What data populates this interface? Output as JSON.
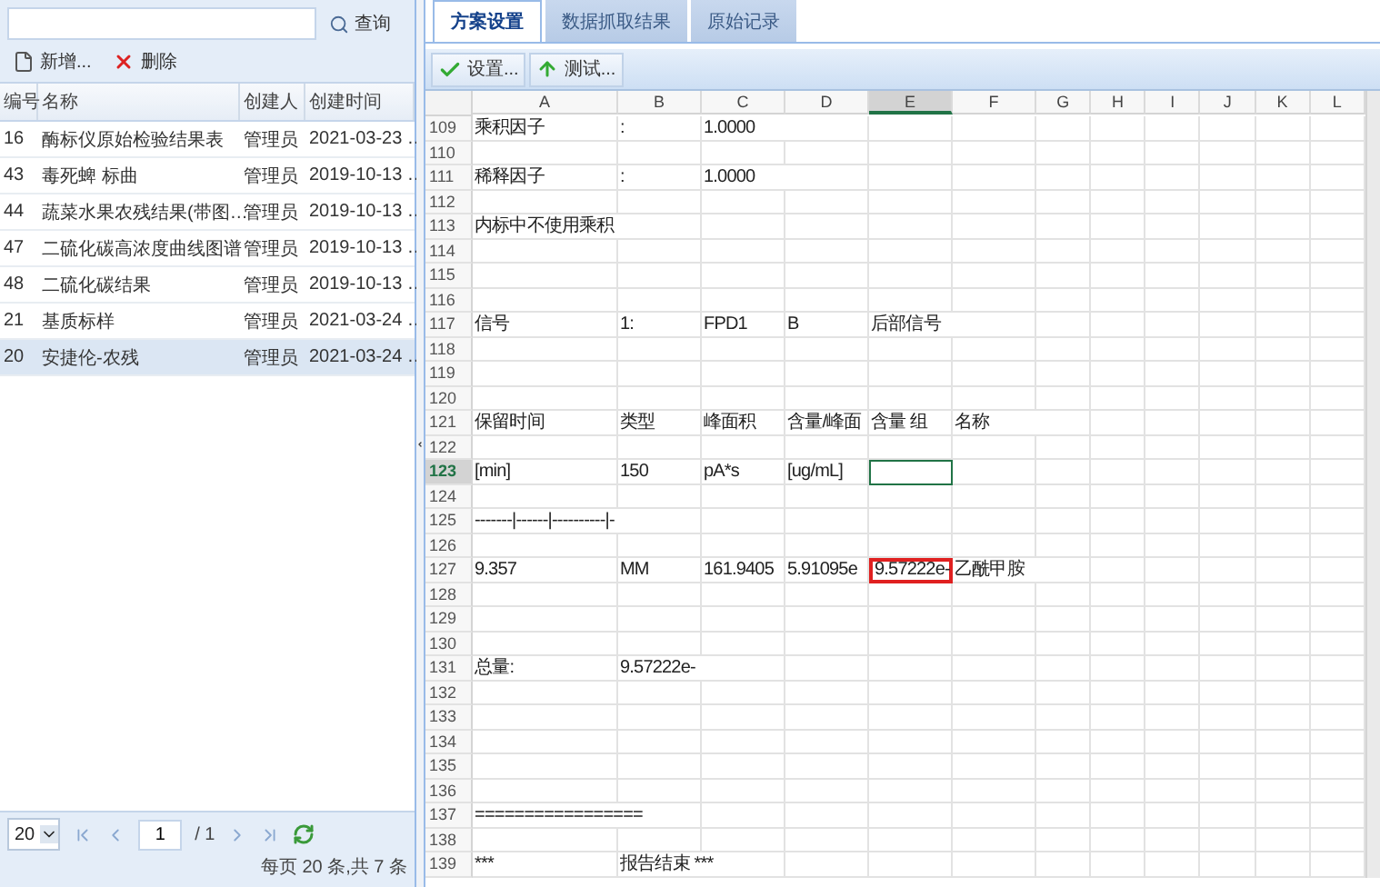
{
  "left_panel": {
    "search": {
      "button": "查询"
    },
    "toolbar": [
      {
        "kind": "add",
        "label": "新增..."
      },
      {
        "kind": "delete",
        "label": "删除"
      }
    ],
    "table": {
      "columns": [
        "编号",
        "名称",
        "创建人",
        "创建时间"
      ],
      "rows": [
        {
          "cells": [
            "16",
            "酶标仪原始检验结果表",
            "管理员",
            "2021-03-23 …"
          ],
          "selected": false
        },
        {
          "cells": [
            "43",
            "毒死蜱 标曲",
            "管理员",
            "2019-10-13 …"
          ],
          "selected": false
        },
        {
          "cells": [
            "44",
            "蔬菜水果农残结果(带图…",
            "管理员",
            "2019-10-13 …"
          ],
          "selected": false
        },
        {
          "cells": [
            "47",
            "二硫化碳高浓度曲线图谱",
            "管理员",
            "2019-10-13 …"
          ],
          "selected": false
        },
        {
          "cells": [
            "48",
            "二硫化碳结果",
            "管理员",
            "2019-10-13 …"
          ],
          "selected": false
        },
        {
          "cells": [
            "21",
            "基质标样",
            "管理员",
            "2021-03-24 …"
          ],
          "selected": false
        },
        {
          "cells": [
            "20",
            "安捷伦-农残",
            "管理员",
            "2021-03-24 …"
          ],
          "selected": true
        }
      ]
    },
    "pager": {
      "page_size": "20",
      "page": "1",
      "page_total": "/ 1",
      "summary": "每页 20 条,共 7 条"
    }
  },
  "right_panel": {
    "tabs": [
      {
        "label": "方案设置",
        "selected": true
      },
      {
        "label": "数据抓取结果",
        "selected": false
      },
      {
        "label": "原始记录",
        "selected": false
      }
    ],
    "toolbar": [
      {
        "kind": "settings",
        "label": "设置..."
      },
      {
        "kind": "test",
        "label": "测试..."
      }
    ],
    "sheet": {
      "columns": [
        {
          "label": "A",
          "selected": false
        },
        {
          "label": "B",
          "selected": false
        },
        {
          "label": "C",
          "selected": false
        },
        {
          "label": "D",
          "selected": false
        },
        {
          "label": "E",
          "selected": true
        },
        {
          "label": "F",
          "selected": false
        },
        {
          "label": "G",
          "selected": false
        },
        {
          "label": "H",
          "selected": false
        },
        {
          "label": "I",
          "selected": false
        },
        {
          "label": "J",
          "selected": false
        },
        {
          "label": "K",
          "selected": false
        },
        {
          "label": "L",
          "selected": false
        }
      ],
      "rows": [
        {
          "number": "109",
          "selected": false,
          "cells": [
            {
              "text": "乘积因子"
            },
            {
              "text": ":"
            },
            {
              "text": "1.0000"
            }
          ]
        },
        {
          "number": "110",
          "selected": false
        },
        {
          "number": "111",
          "selected": false,
          "cells": [
            {
              "text": "稀释因子"
            },
            {
              "text": ":"
            },
            {
              "text": "1.0000"
            }
          ]
        },
        {
          "number": "112",
          "selected": false
        },
        {
          "number": "113",
          "selected": false,
          "cells": [
            {
              "text": "内标中不使用乘积"
            }
          ]
        },
        {
          "number": "114",
          "selected": false
        },
        {
          "number": "115",
          "selected": false
        },
        {
          "number": "116",
          "selected": false
        },
        {
          "number": "117",
          "selected": false,
          "cells": [
            {
              "text": "信号"
            },
            {
              "text": "1:"
            },
            {
              "text": "FPD1"
            },
            {
              "text": "B"
            },
            {
              "text": "后部信号"
            }
          ]
        },
        {
          "number": "118",
          "selected": false
        },
        {
          "number": "119",
          "selected": false
        },
        {
          "number": "120",
          "selected": false
        },
        {
          "number": "121",
          "selected": false,
          "cells": [
            {
              "text": "保留时间"
            },
            {
              "text": "类型"
            },
            {
              "text": "峰面积"
            },
            {
              "text": "含量/峰面"
            },
            {
              "text": "含量 组"
            },
            {
              "text": "名称"
            }
          ]
        },
        {
          "number": "122",
          "selected": false
        },
        {
          "number": "123",
          "selected": true,
          "cells": [
            {
              "text": "[min]"
            },
            {
              "text": "150"
            },
            {
              "text": "pA*s"
            },
            {
              "text": "[ug/mL]"
            }
          ]
        },
        {
          "number": "124",
          "selected": false
        },
        {
          "number": "125",
          "selected": false,
          "cells": [
            {
              "text": "-------|------|----------|-"
            }
          ]
        },
        {
          "number": "126",
          "selected": false
        },
        {
          "number": "127",
          "selected": false,
          "cells": [
            {
              "text": "9.357",
              "highlighted": false
            },
            {
              "text": "MM",
              "highlighted": false
            },
            {
              "text": "161.9405",
              "highlighted": false
            },
            {
              "text": "5.91095e",
              "highlighted": false
            },
            {
              "text": "9.57222e-",
              "highlighted": true
            },
            {
              "text": "乙酰甲胺",
              "highlighted": false
            }
          ]
        },
        {
          "number": "128",
          "selected": false
        },
        {
          "number": "129",
          "selected": false
        },
        {
          "number": "130",
          "selected": false
        },
        {
          "number": "131",
          "selected": false,
          "cells": [
            {
              "text": "总量:"
            },
            {
              "text": "9.57222e-"
            }
          ]
        },
        {
          "number": "132",
          "selected": false
        },
        {
          "number": "133",
          "selected": false
        },
        {
          "number": "134",
          "selected": false
        },
        {
          "number": "135",
          "selected": false
        },
        {
          "number": "136",
          "selected": false
        },
        {
          "number": "137",
          "selected": false,
          "cells": [
            {
              "text": "================="
            }
          ]
        },
        {
          "number": "138",
          "selected": false
        },
        {
          "number": "139",
          "selected": false,
          "cells": [
            {
              "text": "***"
            },
            {
              "text": "报告结束 ***"
            }
          ]
        }
      ]
    }
  }
}
